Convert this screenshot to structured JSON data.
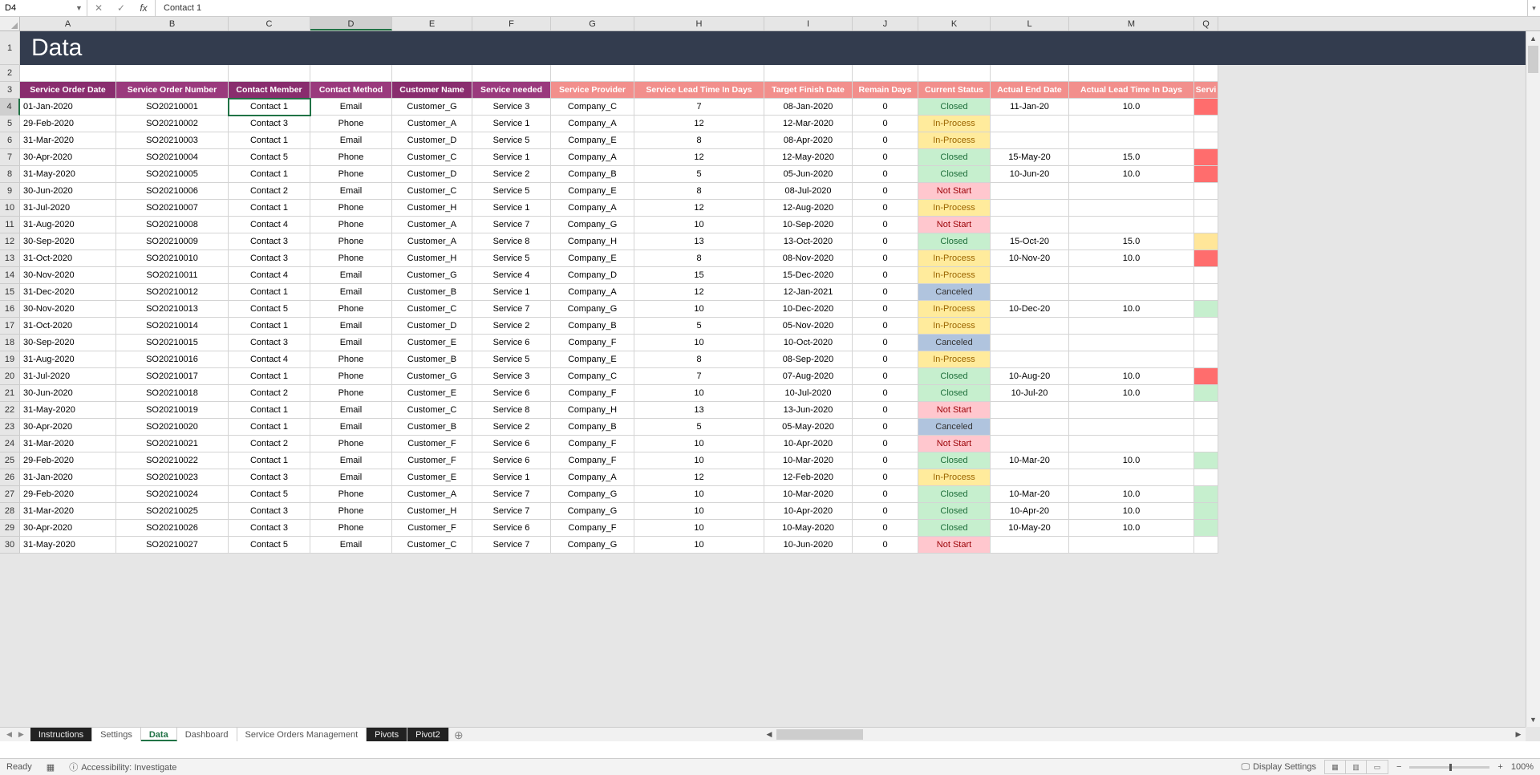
{
  "formula_bar": {
    "name_box": "D4",
    "fx_label": "fx",
    "formula": "Contact 1"
  },
  "col_letters": [
    "A",
    "B",
    "C",
    "D",
    "E",
    "F",
    "G",
    "H",
    "I",
    "J",
    "K",
    "L",
    "M",
    "Q"
  ],
  "active_col_index": 3,
  "row_1_banner": "Data",
  "row_2_blank": "",
  "headers": [
    {
      "label": "Service Order Date",
      "cls": "purple"
    },
    {
      "label": "Service Order Number",
      "cls": "purple-alt"
    },
    {
      "label": "Contact Member",
      "cls": "purple"
    },
    {
      "label": "Contact Method",
      "cls": "purple-alt"
    },
    {
      "label": "Customer Name",
      "cls": "purple"
    },
    {
      "label": "Service needed",
      "cls": "purple-alt"
    },
    {
      "label": "Service Provider",
      "cls": "pink"
    },
    {
      "label": "Service Lead Time In Days",
      "cls": "pink"
    },
    {
      "label": "Target Finish Date",
      "cls": "pink"
    },
    {
      "label": "Remain Days",
      "cls": "pink"
    },
    {
      "label": "Current Status",
      "cls": "pink"
    },
    {
      "label": "Actual End Date",
      "cls": "pink"
    },
    {
      "label": "Actual Lead Time In Days",
      "cls": "pink"
    },
    {
      "label": "Servi",
      "cls": "pink"
    }
  ],
  "col_widths": [
    "w-A",
    "w-B",
    "w-C",
    "w-D",
    "w-E",
    "w-F",
    "w-G",
    "w-H",
    "w-I",
    "w-J",
    "w-K",
    "w-L",
    "w-M",
    "w-N"
  ],
  "rows": [
    {
      "r": 4,
      "d": [
        "01-Jan-2020",
        "SO20210001",
        "Contact 1",
        "Email",
        "Customer_G",
        "Service 3",
        "Company_C",
        "7",
        "08-Jan-2020",
        "0",
        "Closed",
        "11-Jan-20",
        "10.0",
        ""
      ],
      "ind": "ind-red"
    },
    {
      "r": 5,
      "d": [
        "29-Feb-2020",
        "SO20210002",
        "Contact 3",
        "Phone",
        "Customer_A",
        "Service 1",
        "Company_A",
        "12",
        "12-Mar-2020",
        "0",
        "In-Process",
        "",
        "",
        ""
      ],
      "ind": ""
    },
    {
      "r": 6,
      "d": [
        "31-Mar-2020",
        "SO20210003",
        "Contact 1",
        "Email",
        "Customer_D",
        "Service 5",
        "Company_E",
        "8",
        "08-Apr-2020",
        "0",
        "In-Process",
        "",
        "",
        ""
      ],
      "ind": ""
    },
    {
      "r": 7,
      "d": [
        "30-Apr-2020",
        "SO20210004",
        "Contact 5",
        "Phone",
        "Customer_C",
        "Service 1",
        "Company_A",
        "12",
        "12-May-2020",
        "0",
        "Closed",
        "15-May-20",
        "15.0",
        ""
      ],
      "ind": "ind-red"
    },
    {
      "r": 8,
      "d": [
        "31-May-2020",
        "SO20210005",
        "Contact 1",
        "Phone",
        "Customer_D",
        "Service 2",
        "Company_B",
        "5",
        "05-Jun-2020",
        "0",
        "Closed",
        "10-Jun-20",
        "10.0",
        ""
      ],
      "ind": "ind-red"
    },
    {
      "r": 9,
      "d": [
        "30-Jun-2020",
        "SO20210006",
        "Contact 2",
        "Email",
        "Customer_C",
        "Service 5",
        "Company_E",
        "8",
        "08-Jul-2020",
        "0",
        "Not Start",
        "",
        "",
        ""
      ],
      "ind": ""
    },
    {
      "r": 10,
      "d": [
        "31-Jul-2020",
        "SO20210007",
        "Contact 1",
        "Phone",
        "Customer_H",
        "Service 1",
        "Company_A",
        "12",
        "12-Aug-2020",
        "0",
        "In-Process",
        "",
        "",
        ""
      ],
      "ind": ""
    },
    {
      "r": 11,
      "d": [
        "31-Aug-2020",
        "SO20210008",
        "Contact 4",
        "Phone",
        "Customer_A",
        "Service 7",
        "Company_G",
        "10",
        "10-Sep-2020",
        "0",
        "Not Start",
        "",
        "",
        ""
      ],
      "ind": ""
    },
    {
      "r": 12,
      "d": [
        "30-Sep-2020",
        "SO20210009",
        "Contact 3",
        "Phone",
        "Customer_A",
        "Service 8",
        "Company_H",
        "13",
        "13-Oct-2020",
        "0",
        "Closed",
        "15-Oct-20",
        "15.0",
        ""
      ],
      "ind": "ind-yellow"
    },
    {
      "r": 13,
      "d": [
        "31-Oct-2020",
        "SO20210010",
        "Contact 3",
        "Phone",
        "Customer_H",
        "Service 5",
        "Company_E",
        "8",
        "08-Nov-2020",
        "0",
        "In-Process",
        "10-Nov-20",
        "10.0",
        ""
      ],
      "ind": "ind-red"
    },
    {
      "r": 14,
      "d": [
        "30-Nov-2020",
        "SO20210011",
        "Contact 4",
        "Email",
        "Customer_G",
        "Service 4",
        "Company_D",
        "15",
        "15-Dec-2020",
        "0",
        "In-Process",
        "",
        "",
        ""
      ],
      "ind": ""
    },
    {
      "r": 15,
      "d": [
        "31-Dec-2020",
        "SO20210012",
        "Contact 1",
        "Email",
        "Customer_B",
        "Service 1",
        "Company_A",
        "12",
        "12-Jan-2021",
        "0",
        "Canceled",
        "",
        "",
        ""
      ],
      "ind": ""
    },
    {
      "r": 16,
      "d": [
        "30-Nov-2020",
        "SO20210013",
        "Contact 5",
        "Phone",
        "Customer_C",
        "Service 7",
        "Company_G",
        "10",
        "10-Dec-2020",
        "0",
        "In-Process",
        "10-Dec-20",
        "10.0",
        ""
      ],
      "ind": "ind-green"
    },
    {
      "r": 17,
      "d": [
        "31-Oct-2020",
        "SO20210014",
        "Contact 1",
        "Email",
        "Customer_D",
        "Service 2",
        "Company_B",
        "5",
        "05-Nov-2020",
        "0",
        "In-Process",
        "",
        "",
        ""
      ],
      "ind": ""
    },
    {
      "r": 18,
      "d": [
        "30-Sep-2020",
        "SO20210015",
        "Contact 3",
        "Email",
        "Customer_E",
        "Service 6",
        "Company_F",
        "10",
        "10-Oct-2020",
        "0",
        "Canceled",
        "",
        "",
        ""
      ],
      "ind": ""
    },
    {
      "r": 19,
      "d": [
        "31-Aug-2020",
        "SO20210016",
        "Contact 4",
        "Phone",
        "Customer_B",
        "Service 5",
        "Company_E",
        "8",
        "08-Sep-2020",
        "0",
        "In-Process",
        "",
        "",
        ""
      ],
      "ind": ""
    },
    {
      "r": 20,
      "d": [
        "31-Jul-2020",
        "SO20210017",
        "Contact 1",
        "Phone",
        "Customer_G",
        "Service 3",
        "Company_C",
        "7",
        "07-Aug-2020",
        "0",
        "Closed",
        "10-Aug-20",
        "10.0",
        ""
      ],
      "ind": "ind-red"
    },
    {
      "r": 21,
      "d": [
        "30-Jun-2020",
        "SO20210018",
        "Contact 2",
        "Phone",
        "Customer_E",
        "Service 6",
        "Company_F",
        "10",
        "10-Jul-2020",
        "0",
        "Closed",
        "10-Jul-20",
        "10.0",
        ""
      ],
      "ind": "ind-green"
    },
    {
      "r": 22,
      "d": [
        "31-May-2020",
        "SO20210019",
        "Contact 1",
        "Email",
        "Customer_C",
        "Service 8",
        "Company_H",
        "13",
        "13-Jun-2020",
        "0",
        "Not Start",
        "",
        "",
        ""
      ],
      "ind": ""
    },
    {
      "r": 23,
      "d": [
        "30-Apr-2020",
        "SO20210020",
        "Contact 1",
        "Email",
        "Customer_B",
        "Service 2",
        "Company_B",
        "5",
        "05-May-2020",
        "0",
        "Canceled",
        "",
        "",
        ""
      ],
      "ind": ""
    },
    {
      "r": 24,
      "d": [
        "31-Mar-2020",
        "SO20210021",
        "Contact 2",
        "Phone",
        "Customer_F",
        "Service 6",
        "Company_F",
        "10",
        "10-Apr-2020",
        "0",
        "Not Start",
        "",
        "",
        ""
      ],
      "ind": ""
    },
    {
      "r": 25,
      "d": [
        "29-Feb-2020",
        "SO20210022",
        "Contact 1",
        "Email",
        "Customer_F",
        "Service 6",
        "Company_F",
        "10",
        "10-Mar-2020",
        "0",
        "Closed",
        "10-Mar-20",
        "10.0",
        ""
      ],
      "ind": "ind-green"
    },
    {
      "r": 26,
      "d": [
        "31-Jan-2020",
        "SO20210023",
        "Contact 3",
        "Email",
        "Customer_E",
        "Service 1",
        "Company_A",
        "12",
        "12-Feb-2020",
        "0",
        "In-Process",
        "",
        "",
        ""
      ],
      "ind": ""
    },
    {
      "r": 27,
      "d": [
        "29-Feb-2020",
        "SO20210024",
        "Contact 5",
        "Phone",
        "Customer_A",
        "Service 7",
        "Company_G",
        "10",
        "10-Mar-2020",
        "0",
        "Closed",
        "10-Mar-20",
        "10.0",
        ""
      ],
      "ind": "ind-green"
    },
    {
      "r": 28,
      "d": [
        "31-Mar-2020",
        "SO20210025",
        "Contact 3",
        "Phone",
        "Customer_H",
        "Service 7",
        "Company_G",
        "10",
        "10-Apr-2020",
        "0",
        "Closed",
        "10-Apr-20",
        "10.0",
        ""
      ],
      "ind": "ind-green"
    },
    {
      "r": 29,
      "d": [
        "30-Apr-2020",
        "SO20210026",
        "Contact 3",
        "Phone",
        "Customer_F",
        "Service 6",
        "Company_F",
        "10",
        "10-May-2020",
        "0",
        "Closed",
        "10-May-20",
        "10.0",
        ""
      ],
      "ind": "ind-green"
    },
    {
      "r": 30,
      "d": [
        "31-May-2020",
        "SO20210027",
        "Contact 5",
        "Email",
        "Customer_C",
        "Service 7",
        "Company_G",
        "10",
        "10-Jun-2020",
        "0",
        "Not Start",
        "",
        "",
        ""
      ],
      "ind": ""
    }
  ],
  "selected_cell": {
    "row": 4,
    "col": 3
  },
  "tabs": [
    {
      "label": "Instructions",
      "cls": "dark"
    },
    {
      "label": "Settings",
      "cls": ""
    },
    {
      "label": "Data",
      "cls": "active"
    },
    {
      "label": "Dashboard",
      "cls": ""
    },
    {
      "label": "Service Orders Management",
      "cls": ""
    },
    {
      "label": "Pivots",
      "cls": "dark"
    },
    {
      "label": "Pivot2",
      "cls": "dark"
    }
  ],
  "status": {
    "ready": "Ready",
    "accessibility": "Accessibility: Investigate",
    "display_settings": "Display Settings",
    "zoom": "100%",
    "zoom_minus": "−",
    "zoom_plus": "+"
  },
  "status_classes": {
    "Closed": "st-closed",
    "In-Process": "st-inproc",
    "Not Start": "st-notstart",
    "Canceled": "st-cancel"
  }
}
